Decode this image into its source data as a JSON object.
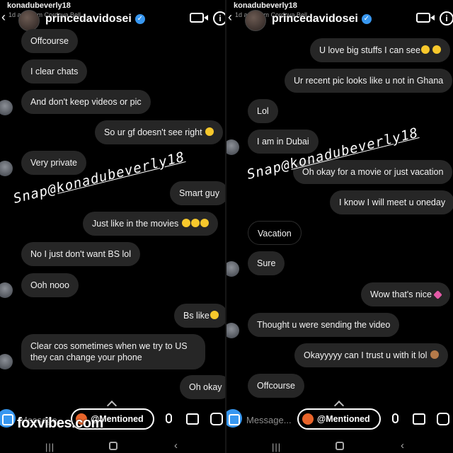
{
  "left": {
    "top_username": "konadubeverly18",
    "top_ago": "1d ago from Cordova Bell",
    "handle": "princedavidosei",
    "messages": [
      "Offcourse",
      "I clear chats",
      "And don't keep videos or pic",
      "So ur gf doesn't see right",
      "Very private",
      "Smart guy",
      "Just like in the movies",
      "No I just don't want BS lol",
      "Ooh nooo",
      "Bs like",
      "Clear cos sometimes when we try to US they can change your phone",
      "Oh okay"
    ],
    "watermark_prefix": "Snap@",
    "watermark_handle": "konadubeverly18",
    "composer": {
      "placeholder": "Message...",
      "mention_label": "@Mentioned"
    },
    "site_watermark": "foxvibes.com"
  },
  "right": {
    "top_username": "konadubeverly18",
    "top_ago": "1d ago from Cordova Bell",
    "handle": "princedavidosei",
    "messages": [
      "U love big stuffs I can see",
      "Ur recent pic looks like u not in Ghana",
      "Lol",
      "I am in Dubai",
      "Oh okay for a movie or just vacation",
      "I know I will meet u oneday",
      "Vacation",
      "Sure",
      "Wow that's nice",
      "Thought u were sending the video",
      "Okayyyyy can I trust u with it lol",
      "Offcourse"
    ],
    "watermark_prefix": "Snap@",
    "watermark_handle": "konadubeverly18",
    "composer": {
      "placeholder": "Message...",
      "mention_label": "@Mentioned"
    }
  },
  "icons": {
    "back": "chevron-left-icon",
    "video_call": "video-camera-icon",
    "info": "info-icon",
    "verified": "verified-badge-icon",
    "camera": "camera-icon",
    "mic": "microphone-icon",
    "gallery": "gallery-icon",
    "sticker": "sticker-icon"
  },
  "colors": {
    "background": "#000000",
    "bubble": "#262626",
    "verified": "#3897f0",
    "camera_button": "#3797f0"
  }
}
